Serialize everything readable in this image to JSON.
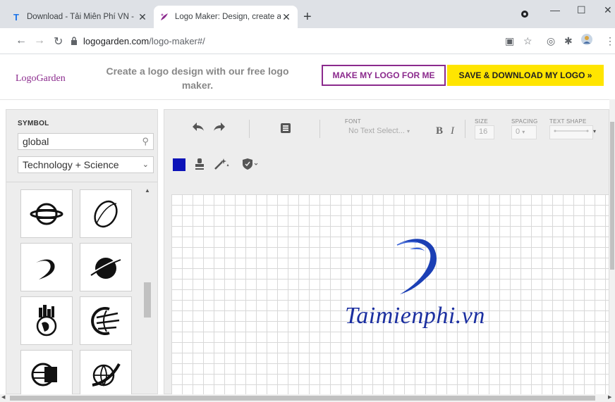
{
  "browser": {
    "tabs": [
      {
        "label": "Download - Tải Miễn Phí VN - Ph",
        "favicon": "T",
        "favicon_color": "#1a73e8",
        "active": false
      },
      {
        "label": "Logo Maker: Design, create and",
        "favicon": "logogarden-leaf",
        "favicon_color": "#8b2a8d",
        "active": true
      }
    ],
    "new_tab": "+",
    "address_host": "logogarden.com",
    "address_path": "/logo-maker#/"
  },
  "header": {
    "logo": "LogoGarden",
    "tagline": "Create a logo design with our free logo maker.",
    "make_button": "MAKE MY LOGO FOR ME",
    "save_button": "SAVE & DOWNLOAD MY LOGO »"
  },
  "symbol_panel": {
    "label": "SYMBOL",
    "search_value": "global",
    "category": "Technology + Science",
    "symbols": [
      "ringed-planet",
      "oval-swoosh",
      "swoosh-arc",
      "saturn-planet",
      "globe-skyline",
      "globe-lines",
      "globe-box",
      "globe-orbit"
    ]
  },
  "toolbar": {
    "font_label": "FONT",
    "font_placeholder": "No Text Select...",
    "bold": "B",
    "italic": "I",
    "size_label": "SIZE",
    "size_value": "16",
    "spacing_label": "SPACING",
    "spacing_value": "0",
    "shape_label": "TEXT SHAPE",
    "color_swatch": "#0d13b8"
  },
  "canvas": {
    "brand_text": "Taimienphi.vn",
    "brand_color": "#1b2fa0"
  }
}
